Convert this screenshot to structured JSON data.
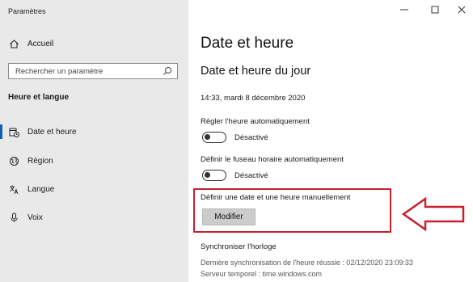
{
  "window": {
    "title": "Paramètres",
    "controls": [
      "minimize",
      "maximize",
      "close"
    ]
  },
  "sidebar": {
    "home_label": "Accueil",
    "search_placeholder": "Rechercher un paramètre",
    "section_title": "Heure et langue",
    "items": [
      {
        "label": "Date et heure",
        "icon": "calendar-clock-icon",
        "active": true
      },
      {
        "label": "Région",
        "icon": "globe-icon",
        "active": false
      },
      {
        "label": "Langue",
        "icon": "language-icon",
        "active": false
      },
      {
        "label": "Voix",
        "icon": "microphone-icon",
        "active": false
      }
    ]
  },
  "main": {
    "title": "Date et heure",
    "subtitle": "Date et heure du jour",
    "current_datetime": "14:33, mardi 8 décembre 2020",
    "auto_time": {
      "label": "Régler l'heure automatiquement",
      "state": "Désactivé"
    },
    "auto_timezone": {
      "label": "Définir le fuseau horaire automatiquement",
      "state": "Désactivé"
    },
    "manual": {
      "label": "Définir une date et une heure manuellement",
      "button": "Modifier"
    },
    "sync": {
      "title": "Synchroniser l'horloge",
      "last_sync": "Dernière synchronisation de l'heure réussie : 02/12/2020 23:09:33",
      "server": "Serveur temporel : time.windows.com"
    }
  },
  "colors": {
    "accent": "#0f5fb0",
    "highlight": "#c8202f",
    "sidebar_bg": "#e9e9e9"
  }
}
